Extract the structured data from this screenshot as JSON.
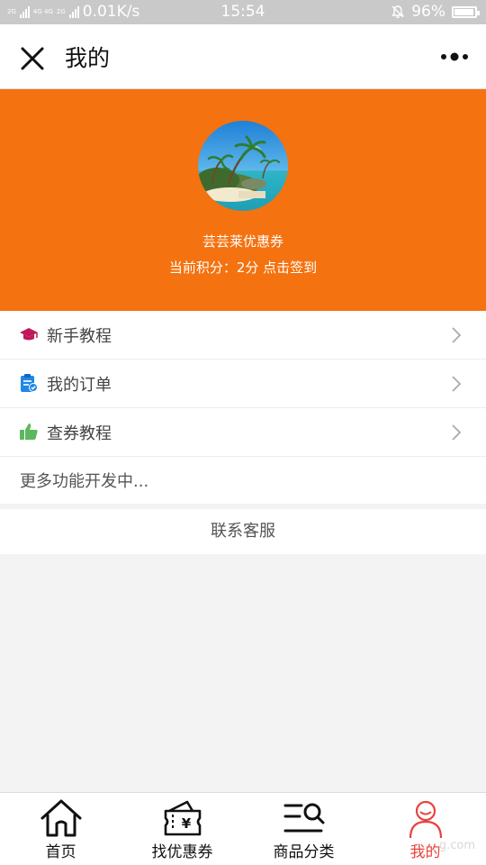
{
  "status_bar": {
    "network_small_1": "2G",
    "network_small_2": "4G 4G",
    "network_small_3": "2G",
    "speed": "0.01K/s",
    "time": "15:54",
    "battery": "96%"
  },
  "navbar": {
    "title": "我的",
    "close_icon": "close-icon",
    "more_icon": "more-dots-icon"
  },
  "profile": {
    "shop_name": "芸芸莱优惠券",
    "points_text": "当前积分：2分 点击签到",
    "background_color": "#f4720f"
  },
  "menu": {
    "items": [
      {
        "label": "新手教程",
        "icon": "graduation-cap-icon",
        "icon_color": "#c2185b"
      },
      {
        "label": "我的订单",
        "icon": "clipboard-check-icon",
        "icon_color": "#1e88e5"
      },
      {
        "label": "查券教程",
        "icon": "thumbs-up-icon",
        "icon_color": "#5cb85c"
      }
    ],
    "more_text": "更多功能开发中..."
  },
  "service": {
    "label": "联系客服"
  },
  "tabbar": {
    "active_color": "#e8433f",
    "tabs": [
      {
        "label": "首页",
        "icon": "home-icon"
      },
      {
        "label": "找优惠券",
        "icon": "coupon-icon"
      },
      {
        "label": "商品分类",
        "icon": "category-search-icon"
      },
      {
        "label": "我的",
        "icon": "user-icon",
        "active": true
      }
    ],
    "watermark": "g.com"
  }
}
